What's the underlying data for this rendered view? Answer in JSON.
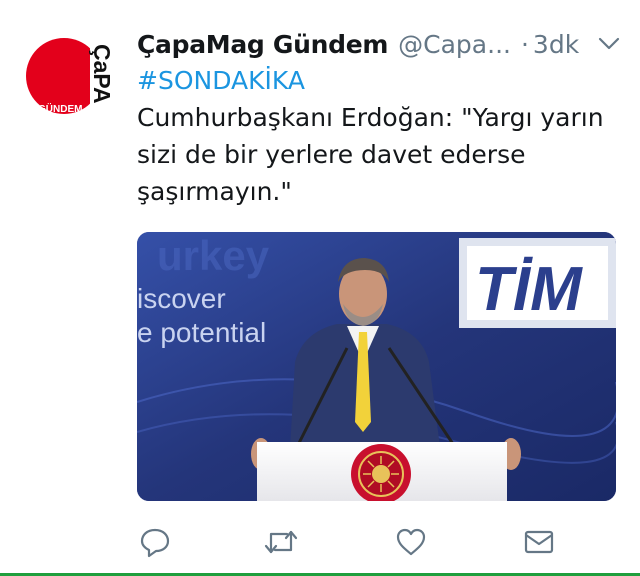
{
  "tweet": {
    "display_name": "ÇapaMag Gündem",
    "handle": "@Capa...",
    "separator": "·",
    "time": "3dk",
    "hashtag": "#SONDAKİKA",
    "text": "Cumhurbaşkanı Erdoğan: \"Yargı yarın sizi de bir yerlere davet ederse şaşırmayın.\""
  },
  "avatar": {
    "logo_text": "ÇaPA",
    "sub_text": "GÜNDEM",
    "colors": {
      "circle": "#e3001b",
      "text": "#111111"
    }
  },
  "media": {
    "backdrop_left_text_1": "iscover",
    "backdrop_left_text_2": "e potential",
    "backdrop_top_text": "urkey",
    "backdrop_logo_text": "TİM"
  },
  "actions": [
    {
      "name": "reply-icon"
    },
    {
      "name": "retweet-icon"
    },
    {
      "name": "like-icon"
    },
    {
      "name": "message-icon"
    }
  ],
  "colors": {
    "link": "#1b95e0",
    "icon": "#657786",
    "text": "#14171a"
  }
}
